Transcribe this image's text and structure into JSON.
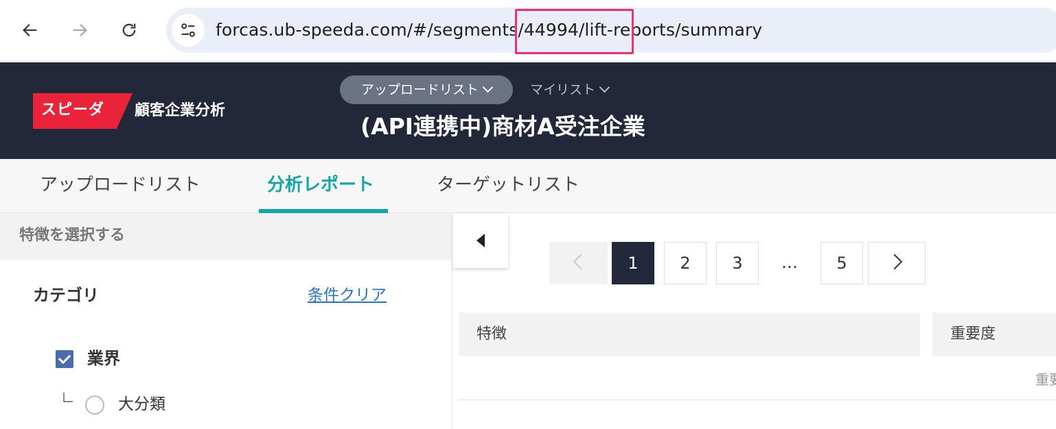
{
  "browser": {
    "url": "forcas.ub-speeda.com/#/segments/44994/lift-reports/summary",
    "icons": [
      "back-arrow-icon",
      "forward-arrow-icon",
      "reload-icon",
      "site-settings-icon"
    ]
  },
  "header": {
    "logo": "スピーダ",
    "app_name": "顧客企業分析",
    "list_dropdown": "アップロードリスト",
    "mylist_dropdown": "マイリスト",
    "segment_title": "(API連携中)商材A受注企業",
    "brand_color": "#e8233a"
  },
  "tabs": [
    {
      "label": "アップロードリスト",
      "active": false
    },
    {
      "label": "分析レポート",
      "active": true
    },
    {
      "label": "ターゲットリスト",
      "active": false
    }
  ],
  "sidebar": {
    "heading": "特徴を選択する",
    "category_label": "カテゴリ",
    "clear_link": "条件クリア",
    "checkbox_item": {
      "label": "業界",
      "checked": true
    },
    "radio_item": {
      "label": "大分類",
      "selected": false
    }
  },
  "pagination": {
    "pages": [
      "1",
      "2",
      "3",
      "…",
      "5"
    ],
    "current": "1"
  },
  "table": {
    "columns": [
      "特徴",
      "重要度"
    ],
    "subheader_text": "重要"
  }
}
